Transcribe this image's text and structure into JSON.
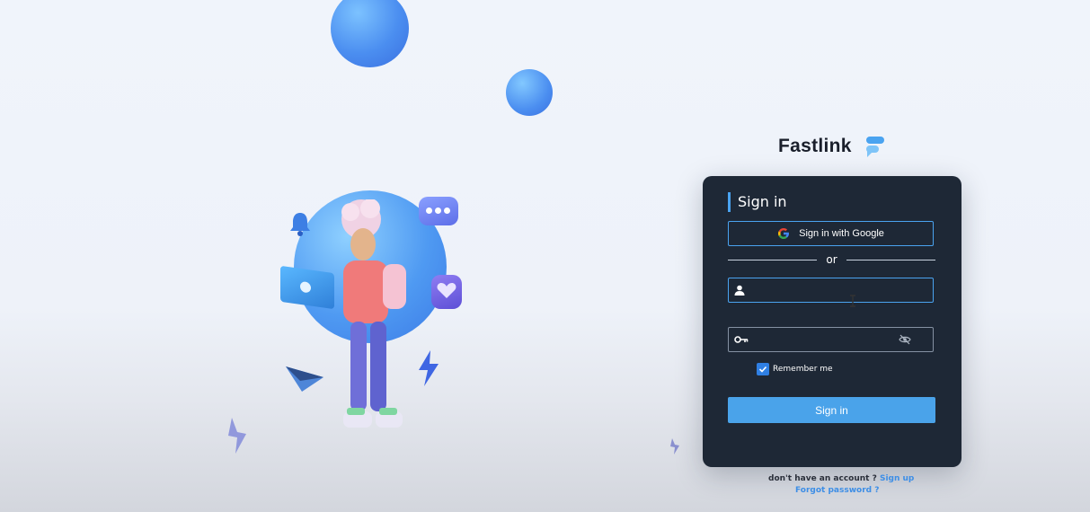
{
  "brand": {
    "name": "Fastlink",
    "accent": "#4aa3f0"
  },
  "card": {
    "title": "Sign in",
    "google_label": "Sign in with Google",
    "divider_text": "or",
    "username": {
      "value": "",
      "placeholder": ""
    },
    "password": {
      "value": "",
      "placeholder": ""
    },
    "remember_label": "Remember me",
    "remember_checked": true,
    "submit_label": "Sign in",
    "bg_color": "#1e2836"
  },
  "footer": {
    "no_account_text": "don't have an account ?",
    "signup_link": "Sign up",
    "forgot_link": "Forgot password ?"
  },
  "icons": [
    "google-icon",
    "user-icon",
    "key-icon",
    "eye-slash-icon",
    "check-icon",
    "logo-icon"
  ]
}
